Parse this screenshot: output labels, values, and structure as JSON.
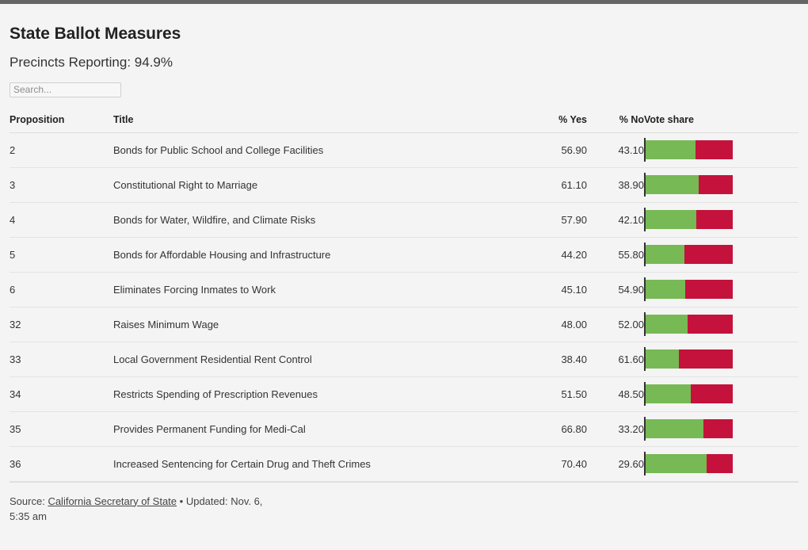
{
  "window": {
    "chrome_bar_color": "#656565",
    "background_color": "#f4f4f4"
  },
  "header": {
    "title": "State Ballot Measures",
    "subtitle": "Precincts Reporting: 94.9%",
    "precincts_reporting_pct": 94.9
  },
  "search": {
    "placeholder": "Search...",
    "value": ""
  },
  "table": {
    "columns": [
      {
        "key": "proposition",
        "label": "Proposition",
        "align": "left"
      },
      {
        "key": "title",
        "label": "Title",
        "align": "left"
      },
      {
        "key": "yes",
        "label": "% Yes",
        "align": "right"
      },
      {
        "key": "no",
        "label": "% No",
        "align": "right"
      },
      {
        "key": "share",
        "label": "Vote share",
        "align": "left"
      }
    ],
    "rows": [
      {
        "proposition": "2",
        "title": "Bonds for Public School and College Facilities",
        "yes": "56.90",
        "no": "43.10",
        "yes_pct": 56.9,
        "no_pct": 43.1
      },
      {
        "proposition": "3",
        "title": "Constitutional Right to Marriage",
        "yes": "61.10",
        "no": "38.90",
        "yes_pct": 61.1,
        "no_pct": 38.9
      },
      {
        "proposition": "4",
        "title": "Bonds for Water, Wildfire, and Climate Risks",
        "yes": "57.90",
        "no": "42.10",
        "yes_pct": 57.9,
        "no_pct": 42.1
      },
      {
        "proposition": "5",
        "title": "Bonds for Affordable Housing and Infrastructure",
        "yes": "44.20",
        "no": "55.80",
        "yes_pct": 44.2,
        "no_pct": 55.8
      },
      {
        "proposition": "6",
        "title": "Eliminates Forcing Inmates to Work",
        "yes": "45.10",
        "no": "54.90",
        "yes_pct": 45.1,
        "no_pct": 54.9
      },
      {
        "proposition": "32",
        "title": "Raises Minimum Wage",
        "yes": "48.00",
        "no": "52.00",
        "yes_pct": 48.0,
        "no_pct": 52.0
      },
      {
        "proposition": "33",
        "title": "Local Government Residential Rent Control",
        "yes": "38.40",
        "no": "61.60",
        "yes_pct": 38.4,
        "no_pct": 61.6
      },
      {
        "proposition": "34",
        "title": "Restricts Spending of Prescription Revenues",
        "yes": "51.50",
        "no": "48.50",
        "yes_pct": 51.5,
        "no_pct": 48.5
      },
      {
        "proposition": "35",
        "title": "Provides Permanent Funding for Medi-Cal",
        "yes": "66.80",
        "no": "33.20",
        "yes_pct": 66.8,
        "no_pct": 33.2
      },
      {
        "proposition": "36",
        "title": "Increased Sentencing for Certain Drug and Theft Crimes",
        "yes": "70.40",
        "no": "29.60",
        "yes_pct": 70.4,
        "no_pct": 29.6
      }
    ]
  },
  "colors": {
    "yes": "#77b955",
    "no": "#c4123c",
    "tick": "#333333",
    "row_rule": "#e3e3e3",
    "header_rule": "#dddddd"
  },
  "footer": {
    "source_prefix": "Source:",
    "source_link": "California Secretary of State",
    "bullet": "•",
    "updated": "Updated: Nov. 6, 5:35 am"
  },
  "chart_data": {
    "type": "bar",
    "title": "State Ballot Measures — Vote share",
    "subtitle": "Precincts Reporting: 94.9%",
    "orientation": "horizontal-stacked",
    "xlabel": "",
    "ylabel": "",
    "xlim": [
      0,
      100
    ],
    "grid": false,
    "legend": null,
    "unit": "percent",
    "categories": [
      "2 — Bonds for Public School and College Facilities",
      "3 — Constitutional Right to Marriage",
      "4 — Bonds for Water, Wildfire, and Climate Risks",
      "5 — Bonds for Affordable Housing and Infrastructure",
      "6 — Eliminates Forcing Inmates to Work",
      "32 — Raises Minimum Wage",
      "33 — Local Government Residential Rent Control",
      "34 — Restricts Spending of Prescription Revenues",
      "35 — Provides Permanent Funding for Medi-Cal",
      "36 — Increased Sentencing for Certain Drug and Theft Crimes"
    ],
    "series": [
      {
        "name": "% Yes",
        "color": "#77b955",
        "values": [
          56.9,
          61.1,
          57.9,
          44.2,
          45.1,
          48.0,
          38.4,
          51.5,
          66.8,
          70.4
        ]
      },
      {
        "name": "% No",
        "color": "#c4123c",
        "values": [
          43.1,
          38.9,
          42.1,
          55.8,
          54.9,
          52.0,
          61.6,
          48.5,
          33.2,
          29.6
        ]
      }
    ]
  }
}
